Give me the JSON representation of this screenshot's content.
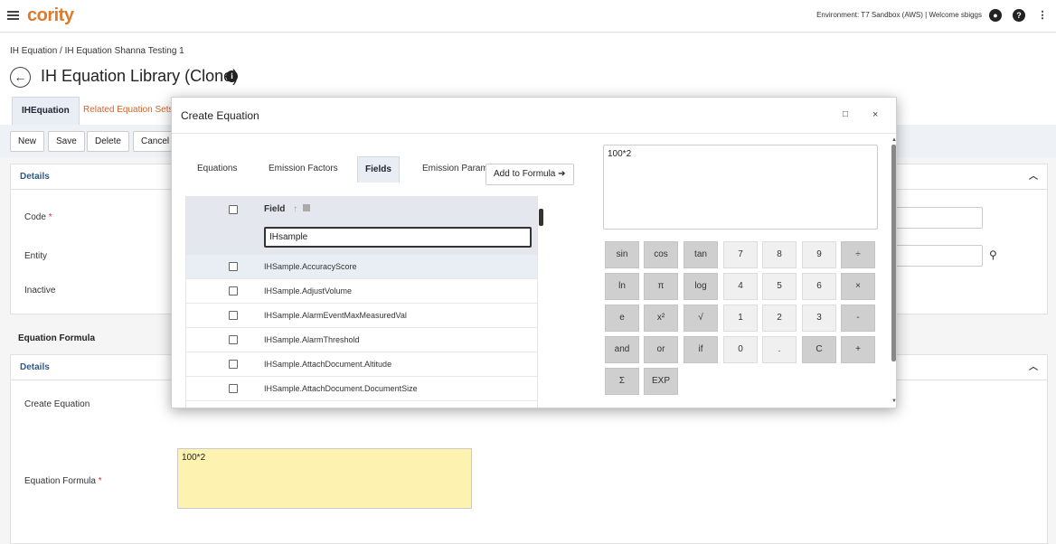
{
  "topbar": {
    "logo": "cority",
    "environment": "Environment: T7 Sandbox (AWS) | Welcome sbiggs",
    "icons": [
      "user-icon",
      "help-icon",
      "menu-icon"
    ]
  },
  "breadcrumb": {
    "parent": "IH Equation",
    "separator": " / ",
    "current": "IH Equation Shanna Testing 1"
  },
  "page": {
    "title": "IH Equation Library (Clone)",
    "info_glyph": "i",
    "back_glyph": "←"
  },
  "tabs": [
    {
      "label": "IHEquation",
      "active": true
    },
    {
      "label": "Related Equation Sets",
      "active": false
    }
  ],
  "toolbar": {
    "new_label": "New",
    "save_label": "Save",
    "delete_label": "Delete",
    "cancel_label": "Cancel"
  },
  "details": {
    "header": "Details",
    "code_label": "Code",
    "entity_label": "Entity",
    "inactive_label": "Inactive"
  },
  "equation_formula": {
    "section_label": "Equation Formula",
    "details_header": "Details",
    "create_label": "Create Equation",
    "formula_label": "Equation Formula",
    "formula_value": "100*2"
  },
  "modal": {
    "title": "Create Equation",
    "maximize_glyph": "□",
    "close_glyph": "×",
    "tabs": [
      {
        "label": "Equations",
        "active": false
      },
      {
        "label": "Emission Factors",
        "active": false
      },
      {
        "label": "Fields",
        "active": true
      },
      {
        "label": "Emission Param",
        "active": false
      }
    ],
    "add_to_formula": "Add to Formula",
    "arrow_glyph": "➔",
    "field_column": "Field",
    "sort_glyph": "↑",
    "filter_value": "IHsample",
    "rows": [
      "IHSample.AccuracyScore",
      "IHSample.AdjustVolume",
      "IHSample.AlarmEventMaxMeasuredVal",
      "IHSample.AlarmThreshold",
      "IHSample.AttachDocument.Altitude",
      "IHSample.AttachDocument.DocumentSize"
    ],
    "formula_value": "100*2",
    "calculator": [
      [
        "sin",
        "cos",
        "tan",
        "7",
        "8",
        "9",
        "÷"
      ],
      [
        "ln",
        "π",
        "log",
        "4",
        "5",
        "6",
        "×"
      ],
      [
        "e",
        "x²",
        "√",
        "1",
        "2",
        "3",
        "-"
      ],
      [
        "and",
        "or",
        "if",
        "0",
        ".",
        "C",
        "+"
      ],
      [
        "Σ",
        "EXP"
      ]
    ]
  }
}
